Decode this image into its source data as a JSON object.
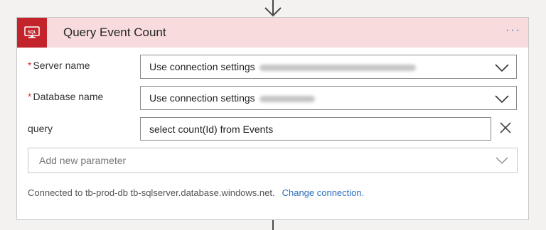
{
  "action": {
    "title": "Query Event Count",
    "more_label": "···",
    "icon": "sql-database-icon",
    "accent_color": "#c3232b",
    "header_bg": "#f8dcdd"
  },
  "fields": {
    "server": {
      "required_mark": "*",
      "label": "Server name",
      "value": "Use connection settings",
      "hint": "(tb-sqlserver.database.windows.net)"
    },
    "database": {
      "required_mark": "*",
      "label": "Database name",
      "value": "Use connection settings",
      "hint": "(tb-prod-db)"
    },
    "query": {
      "label": "query",
      "value": "select count(Id) from Events"
    }
  },
  "add_parameter": {
    "placeholder": "Add new parameter"
  },
  "connection": {
    "status": "Connected to tb-prod-db tb-sqlserver.database.windows.net.",
    "change_link": "Change connection."
  }
}
